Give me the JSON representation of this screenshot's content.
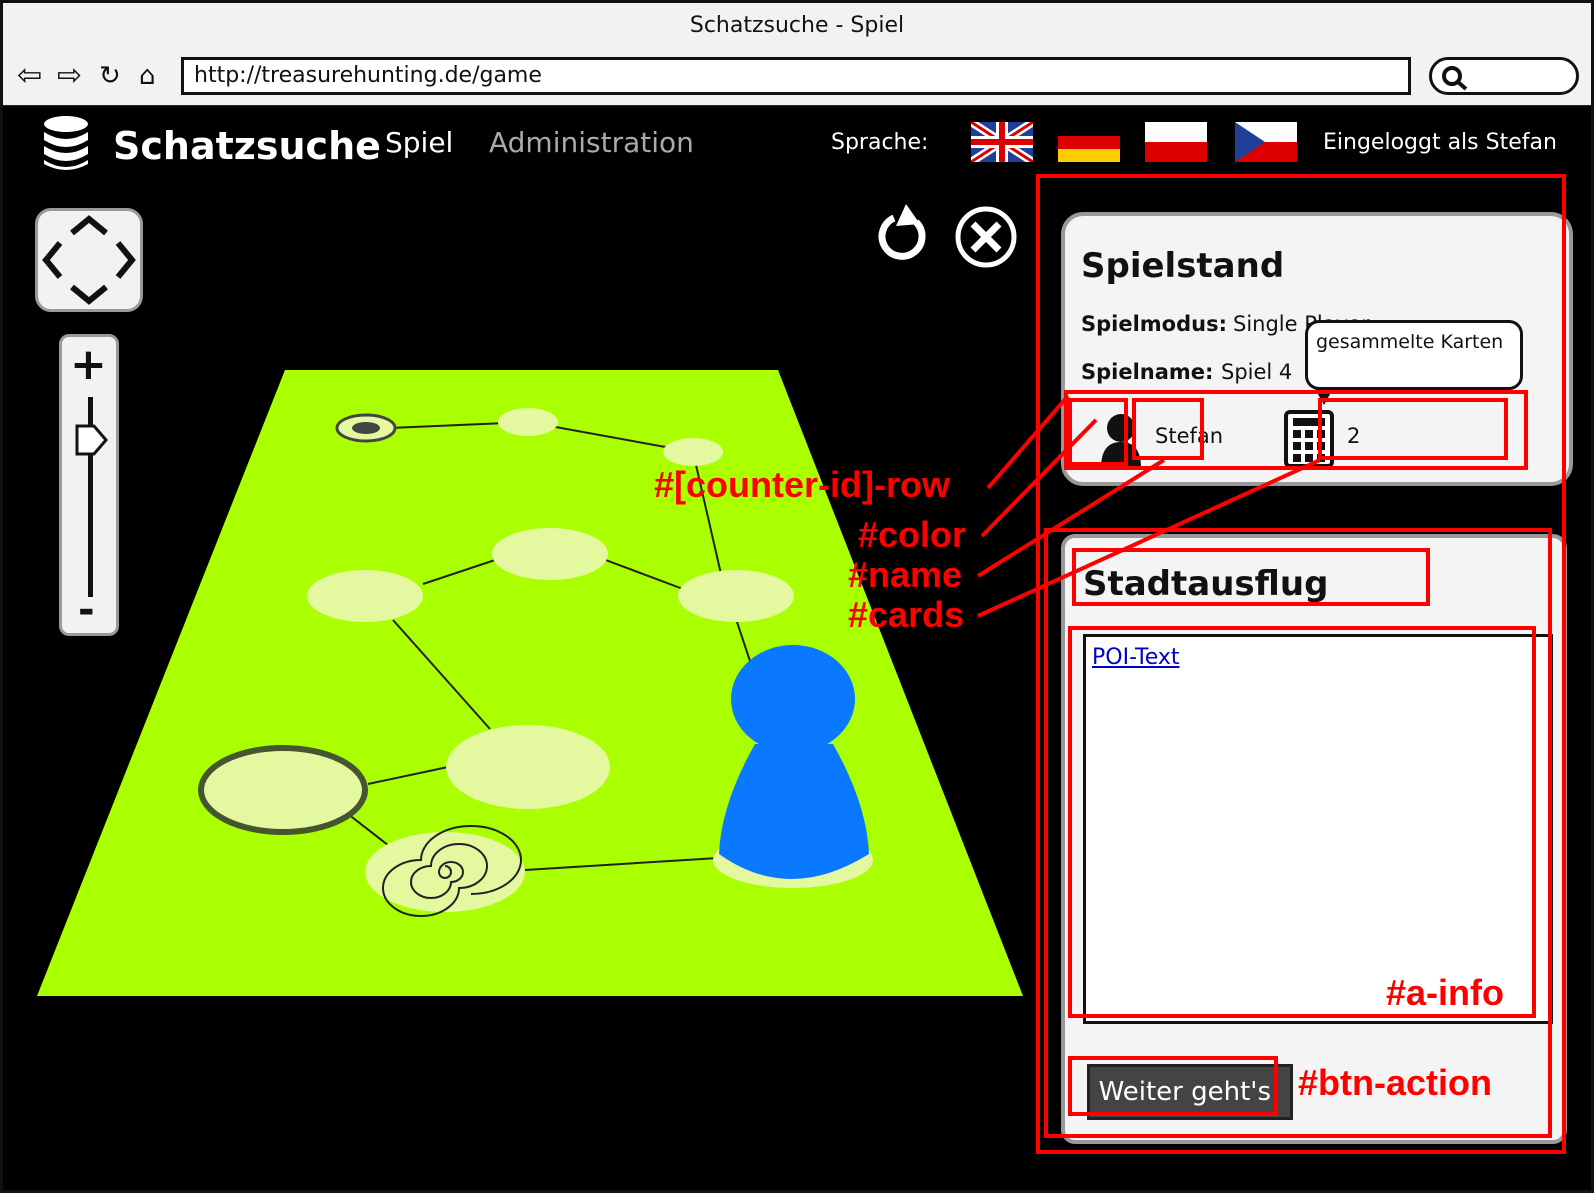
{
  "browser": {
    "title": "Schatzsuche - Spiel",
    "url": "http://treasurehunting.de/game"
  },
  "header": {
    "brand": "Schatzsuche",
    "nav": [
      "Spiel",
      "Administration"
    ],
    "language_label": "Sprache:",
    "languages": [
      "English",
      "Deutsch",
      "Polski",
      "Čeština"
    ],
    "login_text": "Eingeloggt als Stefan"
  },
  "score": {
    "title": "Spielstand",
    "mode_label": "Spielmodus:",
    "mode_value": "Single Player",
    "name_label": "Spielname:",
    "name_value": "Spiel 4",
    "tooltip": "gesammelte Karten",
    "player_name": "Stefan",
    "cards": "2"
  },
  "info": {
    "title": "Stadtausflug",
    "link": "POI-Text",
    "button": "Weiter geht's!"
  },
  "annotations": {
    "row": "#[counter-id]-row",
    "color": "#color",
    "name": "#name",
    "cards": "#cards",
    "info": "#a-info",
    "action": "#btn-action"
  },
  "colors": {
    "board": "#aaff00",
    "field": "#e4f8a0",
    "pawn": "#0a78ff",
    "annotation": "#ff0000"
  }
}
